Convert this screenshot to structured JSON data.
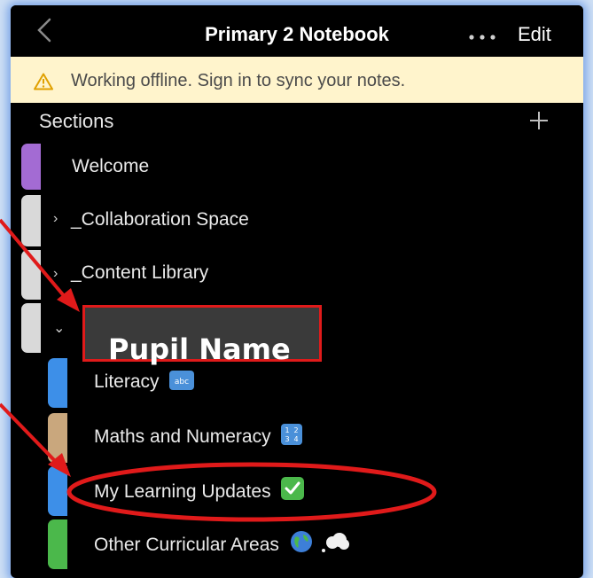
{
  "header": {
    "title": "Primary 2 Notebook",
    "edit_label": "Edit",
    "back_icon": "chevron-left-icon",
    "more_icon": "more-dots-icon"
  },
  "banner": {
    "icon": "warning-icon",
    "text": "Working offline. Sign in to sync your notes."
  },
  "sections": {
    "label": "Sections",
    "add_icon": "plus-icon",
    "items": [
      {
        "label": "Welcome",
        "color": "#a36bd3"
      },
      {
        "label": "_Collaboration Space",
        "color": "#d9d9d9"
      },
      {
        "label": "_Content Library",
        "color": "#d9d9d9"
      },
      {
        "label": "",
        "color": "#d9d9d9"
      },
      {
        "label": "Literacy",
        "color": "#3d8fe8"
      },
      {
        "label": "Maths and Numeracy",
        "color": "#c9a77d"
      },
      {
        "label": "My Learning Updates",
        "color": "#3d8fe8"
      },
      {
        "label": "Other Curricular Areas",
        "color": "#4bb84b"
      }
    ]
  },
  "callout": {
    "text": "Pupil Name"
  },
  "colors": {
    "accent_red": "#e01a1a",
    "warning": "#e0a000"
  }
}
